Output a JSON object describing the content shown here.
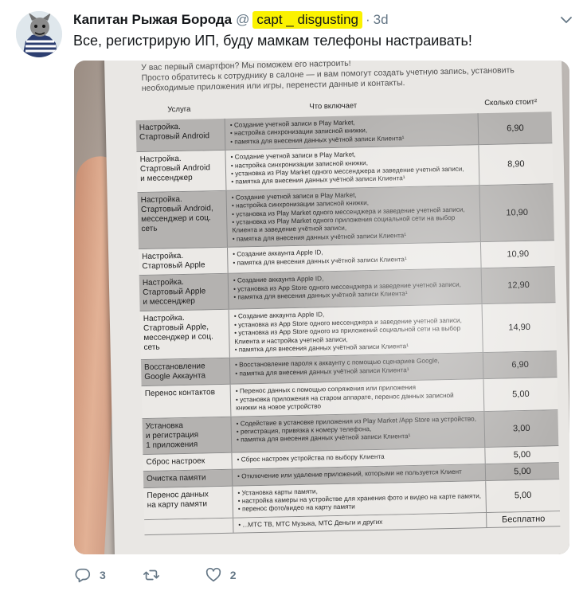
{
  "tweet": {
    "display_name": "Капитан Рыжая Борода",
    "handle_at": "@",
    "handle": "capt _ disgusting",
    "separator": "·",
    "time": "3d",
    "text": "Все, регистрирую ИП, буду мамкам телефоны настраивать!"
  },
  "photo": {
    "intro_lines": [
      "У вас первый смартфон? Мы поможем его настроить!",
      "Просто обратитесь к сотруднику в салоне — и вам помогут создать учетную запись, установить",
      "необходимые приложения или игры, перенести данные и контакты."
    ],
    "columns": [
      "Услуга",
      "Что включает",
      "Сколько стоит²"
    ],
    "rows": [
      {
        "name": "Настройка.\nСтартовый Android",
        "shade": "dark",
        "items": [
          "• Создание учетной записи в Play Market,",
          "• настройка синхронизации записной книжки,",
          "• памятка для внесения данных учётной записи Клиента¹"
        ],
        "price": "6,90"
      },
      {
        "name": "Настройка.\nСтартовый Android\nи мессенджер",
        "shade": "light",
        "items": [
          "• Создание учетной записи в Play Market,",
          "• настройка синхронизации записной книжки,",
          "• установка из Play Market одного мессенджера и заведение учетной записи,",
          "• памятка для внесения данных учётной записи Клиента¹"
        ],
        "price": "8,90"
      },
      {
        "name": "Настройка.\nСтартовый Android,\nмессенджер и соц. сеть",
        "shade": "dark",
        "items": [
          "• Создание учетной записи в Play Market,",
          "• настройка синхронизации записной книжки,",
          "• установка из Play Market одного мессенджера и заведение учетной записи,",
          "• установка из Play Market одного приложения социальной сети на выбор",
          "  Клиента и заведение учётной записи,",
          "• памятка для внесения данных учётной записи Клиента¹"
        ],
        "price": "10,90"
      },
      {
        "name": "Настройка.\nСтартовый Apple",
        "shade": "light",
        "items": [
          "• Создание аккаунта Apple ID,",
          "• памятка для внесения данных учётной записи Клиента¹"
        ],
        "price": "10,90"
      },
      {
        "name": "Настройка.\nСтартовый Apple\nи мессенджер",
        "shade": "dark",
        "items": [
          "• Создание аккаунта Apple ID,",
          "• установка из App Store одного мессенджера и заведение учетной записи,",
          "• памятка для внесения данных учётной записи Клиента¹"
        ],
        "price": "12,90"
      },
      {
        "name": "Настройка.\nСтартовый Apple,\nмессенджер и соц. сеть",
        "shade": "light",
        "items": [
          "• Создание аккаунта Apple ID,",
          "• установка из App Store одного мессенджера и заведение учетной записи,",
          "• установка из App Store одного из приложений социальной сети на выбор",
          "  Клиента и настройка учетной записи,",
          "• памятка для внесения данных учётной записи Клиента¹"
        ],
        "price": "14,90"
      },
      {
        "name": "Восстановление\nGoogle Аккаунта",
        "shade": "dark",
        "items": [
          "• Восстановление пароля к аккаунту с помощью сценариев Google,",
          "• памятка для внесения данных учётной записи Клиента¹"
        ],
        "price": "6,90"
      },
      {
        "name": "Перенос контактов",
        "shade": "light",
        "items": [
          "• Перенос данных с помощью сопряжения или приложения",
          "• установка приложения на старом аппарате, перенос данных записной",
          "  книжки на новое устройство"
        ],
        "price": "5,00"
      },
      {
        "name": "Установка\nи регистрация\n1 приложения",
        "shade": "dark",
        "items": [
          "• Содействие в установке приложения из Play Market /App Store на устройство,",
          "• регистрация, привязка к номеру телефона,",
          "• памятка для внесения данных учётной записи Клиента¹"
        ],
        "price": "3,00"
      },
      {
        "name": "Сброс настроек",
        "shade": "light",
        "items": [
          "• Сброс настроек устройства по выбору Клиента"
        ],
        "price": "5,00"
      },
      {
        "name": "Очистка памяти",
        "shade": "dark",
        "items": [
          "• Отключение или удаление приложений, которыми не пользуется Клиент"
        ],
        "price": "5,00"
      },
      {
        "name": "Перенос данных\nна карту памяти",
        "shade": "light",
        "items": [
          "• Установка карты памяти,",
          "• настройка камеры на устройстве для хранения фото и видео на карте памяти,",
          "• перенос фото/видео на карту памяти"
        ],
        "price": "5,00"
      },
      {
        "name": "",
        "shade": "light",
        "items": [
          "• ...МТС ТВ, МТС Музыка, МТС Деньги и других"
        ],
        "price": "Бесплатно"
      }
    ]
  },
  "actions": {
    "reply_count": "3",
    "retweet_count": "",
    "like_count": "2"
  }
}
